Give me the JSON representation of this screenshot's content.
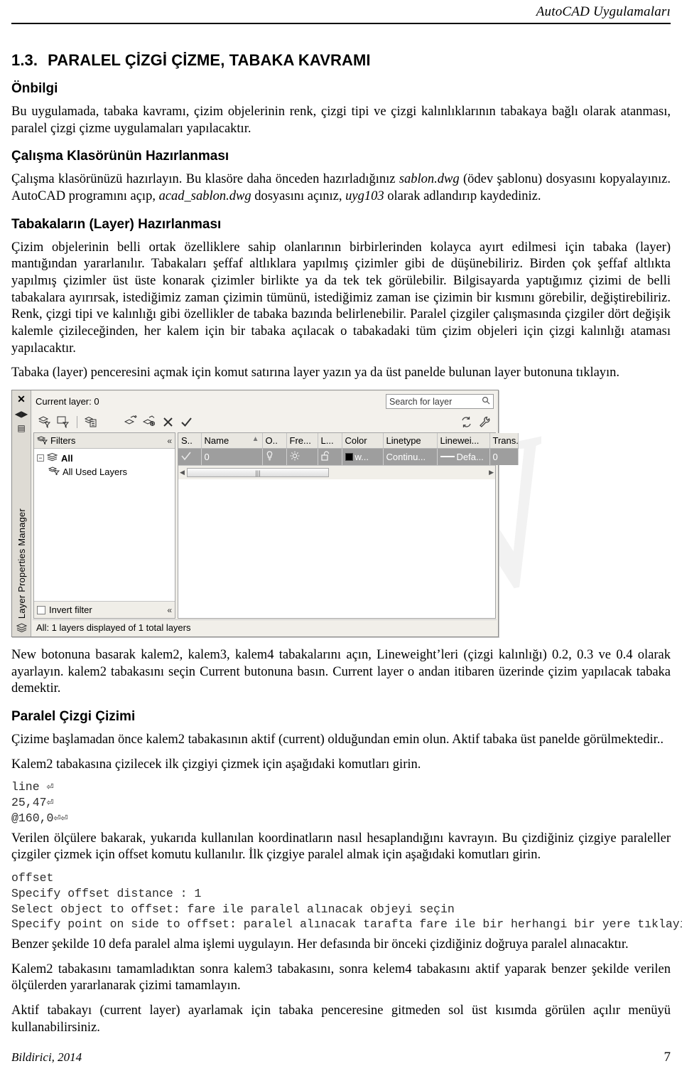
{
  "header": {
    "running_title": "AutoCAD Uygulamaları"
  },
  "section": {
    "number": "1.3.",
    "title": "PARALEL ÇİZGİ ÇİZME, TABAKA KAVRAMI"
  },
  "headings": {
    "onbilgi": "Önbilgi",
    "calisma_klasoru": "Çalışma Klasörünün Hazırlanması",
    "tabakalarin_hazirlanmasi": "Tabakaların (Layer) Hazırlanması",
    "paralel_cizgi_cizimi": "Paralel Çizgi Çizimi"
  },
  "paragraphs": {
    "onbilgi_p1": "Bu uygulamada, tabaka kavramı, çizim objelerinin renk, çizgi tipi ve çizgi kalınlıklarının tabakaya bağlı olarak atanması, paralel çizgi çizme uygulamaları yapılacaktır.",
    "klasor_p1_a": "Çalışma klasörünüzü hazırlayın. Bu klasöre daha önceden hazırladığınız ",
    "klasor_p1_i1": "sablon.dwg",
    "klasor_p1_b": " (ödev şablonu) dosyasını kopyalayınız. AutoCAD programını açıp, ",
    "klasor_p1_i2": "acad_sablon.dwg",
    "klasor_p1_c": " dosyasını açınız, ",
    "klasor_p1_i3": "uyg103",
    "klasor_p1_d": " olarak adlandırıp kaydediniz.",
    "tabaka_p1": "Çizim objelerinin belli ortak özelliklere sahip olanlarının birbirlerinden kolayca ayırt edilmesi için tabaka (layer) mantığından yararlanılır. Tabakaları şeffaf altlıklara yapılmış çizimler gibi de düşünebiliriz. Birden çok şeffaf altlıkta yapılmış çizimler üst üste konarak çizimler birlikte ya da tek tek görülebilir. Bilgisayarda yaptığımız çizimi de belli tabakalara ayırırsak, istediğimiz zaman çizimin tümünü, istediğimiz zaman ise çizimin bir kısmını görebilir, değiştirebiliriz. Renk, çizgi tipi ve kalınlığı gibi özellikler de tabaka bazında belirlenebilir. Paralel çizgiler çalışmasında çizgiler dört değişik kalemle çizileceğinden, her kalem için bir tabaka açılacak o tabakadaki tüm çizim objeleri için çizgi kalınlığı ataması yapılacaktır.",
    "tabaka_p2": "Tabaka (layer) penceresini açmak için komut satırına layer yazın ya da üst panelde bulunan layer butonuna tıklayın.",
    "after_dialog": "New botonuna basarak kalem2, kalem3, kalem4  tabakalarını açın, Lineweight’leri (çizgi kalınlığı) 0.2, 0.3 ve 0.4 olarak ayarlayın. kalem2 tabakasını seçin Current butonuna basın. Current layer o andan itibaren üzerinde çizim yapılacak tabaka demektir.",
    "paralel_p1": "Çizime başlamadan önce kalem2 tabakasının aktif (current) olduğundan emin olun. Aktif tabaka üst panelde görülmektedir..",
    "paralel_p2": "Kalem2 tabakasına çizilecek ilk çizgiyi çizmek için aşağıdaki komutları girin.",
    "paralel_p3": "Verilen ölçülere bakarak, yukarıda kullanılan koordinatların nasıl hesaplandığını kavrayın. Bu çizdiğiniz çizgiye paraleller çizgiler çizmek için offset komutu kullanılır. İlk çizgiye paralel almak için aşağıdaki komutları girin.",
    "paralel_p4": "Benzer şekilde 10 defa paralel alma işlemi uygulayın. Her defasında bir önceki çizdiğiniz doğruya paralel alınacaktır.",
    "paralel_p5": "Kalem2 tabakasını tamamladıktan sonra kalem3 tabakasını, sonra kelem4 tabakasını aktif yaparak benzer şekilde verilen ölçülerden yararlanarak çizimi tamamlayın.",
    "paralel_p6": "Aktif tabakayı (current layer) ayarlamak için tabaka penceresine gitmeden sol üst kısımda görülen açılır menüyü kullanabilirsiniz."
  },
  "command_blocks": {
    "line_block": "line ⏎\n25,47⏎\n@160,0⏎⏎",
    "offset_block": "offset\nSpecify offset distance : 1\nSelect object to offset: fare ile paralel alınacak objeyi seçin\nSpecify point on side to offset: paralel alınacak tarafta fare ile bir herhangi bir yere tıklayın"
  },
  "layer_dialog": {
    "panel_title": "Layer Properties Manager",
    "current_layer": "Current layer: 0",
    "search_placeholder": "Search for layer",
    "toolbar": [
      {
        "name": "new-property-filter",
        "tip": "New Property Filter"
      },
      {
        "name": "new-group-filter",
        "tip": "New Group Filter"
      },
      {
        "name": "layer-states-manager",
        "tip": "Layer States Manager"
      },
      {
        "name": "new-layer",
        "tip": "New Layer"
      },
      {
        "name": "new-layer-vp-frozen",
        "tip": "New Layer VP Frozen in All Viewports"
      },
      {
        "name": "delete-layer",
        "tip": "Delete Layer"
      },
      {
        "name": "set-current",
        "tip": "Set Current"
      },
      {
        "name": "refresh",
        "tip": "Refresh"
      },
      {
        "name": "settings",
        "tip": "Settings"
      }
    ],
    "filters": {
      "header": "Filters",
      "tree": [
        {
          "label": "All",
          "level": 0,
          "selected": true
        },
        {
          "label": "All Used Layers",
          "level": 1,
          "selected": false
        }
      ],
      "invert_filter": "Invert filter"
    },
    "table": {
      "columns": [
        "S..",
        "Name",
        "O..",
        "Fre...",
        "L...",
        "Color",
        "Linetype",
        "Linewei...",
        "Trans."
      ],
      "rows": [
        {
          "status": "✓",
          "name": "0",
          "on": "lightbulb-icon",
          "freeze": "sun-icon",
          "lock": "unlock-icon",
          "color": "w...",
          "color_hex": "#000000",
          "linetype": "Continu...",
          "lineweight": "Defa...",
          "transparency": "0",
          "selected": true
        }
      ]
    },
    "status_bar": "All: 1 layers displayed of 1 total layers"
  },
  "footer": {
    "author_year": "Bildirici, 2014",
    "page_number": "7"
  }
}
